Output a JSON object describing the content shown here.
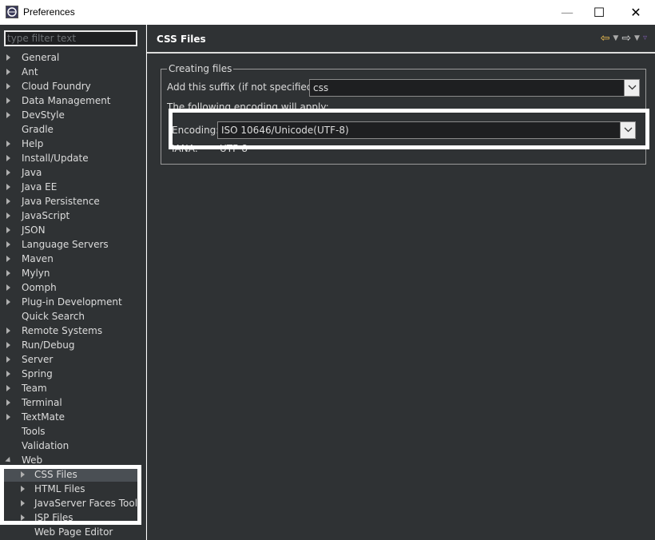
{
  "window": {
    "title": "Preferences",
    "min_glyph": "—",
    "max_glyph": "☐",
    "close_glyph": "✕"
  },
  "filter": {
    "placeholder": "type filter text"
  },
  "tree": {
    "items": [
      {
        "label": "General",
        "expandable": true
      },
      {
        "label": "Ant",
        "expandable": true
      },
      {
        "label": "Cloud Foundry",
        "expandable": true
      },
      {
        "label": "Data Management",
        "expandable": true
      },
      {
        "label": "DevStyle",
        "expandable": true
      },
      {
        "label": "Gradle",
        "expandable": false
      },
      {
        "label": "Help",
        "expandable": true
      },
      {
        "label": "Install/Update",
        "expandable": true
      },
      {
        "label": "Java",
        "expandable": true
      },
      {
        "label": "Java EE",
        "expandable": true
      },
      {
        "label": "Java Persistence",
        "expandable": true
      },
      {
        "label": "JavaScript",
        "expandable": true
      },
      {
        "label": "JSON",
        "expandable": true
      },
      {
        "label": "Language Servers",
        "expandable": true
      },
      {
        "label": "Maven",
        "expandable": true
      },
      {
        "label": "Mylyn",
        "expandable": true
      },
      {
        "label": "Oomph",
        "expandable": true
      },
      {
        "label": "Plug-in Development",
        "expandable": true
      },
      {
        "label": "Quick Search",
        "expandable": false
      },
      {
        "label": "Remote Systems",
        "expandable": true
      },
      {
        "label": "Run/Debug",
        "expandable": true
      },
      {
        "label": "Server",
        "expandable": true
      },
      {
        "label": "Spring",
        "expandable": true
      },
      {
        "label": "Team",
        "expandable": true
      },
      {
        "label": "Terminal",
        "expandable": true
      },
      {
        "label": "TextMate",
        "expandable": true
      },
      {
        "label": "Tools",
        "expandable": false
      },
      {
        "label": "Validation",
        "expandable": false
      },
      {
        "label": "Web",
        "expandable": true,
        "expanded": true
      }
    ],
    "web_children": [
      {
        "label": "CSS Files",
        "expandable": true,
        "selected": true
      },
      {
        "label": "HTML Files",
        "expandable": true
      },
      {
        "label": "JavaServer Faces Tools",
        "expandable": true
      },
      {
        "label": "JSP Files",
        "expandable": true
      },
      {
        "label": "Web Page Editor",
        "expandable": false
      }
    ]
  },
  "page": {
    "title": "CSS Files",
    "group_label": "Creating files",
    "suffix_label": "Add this suffix (if not specified):",
    "suffix_value": "css",
    "encoding_note": "The following encoding will apply:",
    "encoding_label": "Encoding:",
    "encoding_value": "ISO 10646/Unicode(UTF-8)",
    "iana_label": "IANA:",
    "iana_value": "UTF-8"
  },
  "nav_icons": [
    "back-arrow-icon",
    "forward-arrow-icon",
    "view-menu-icon"
  ],
  "colors": {
    "background": "#2f3234",
    "text": "#dcdcdc",
    "back_arrow": "#f0c050"
  }
}
